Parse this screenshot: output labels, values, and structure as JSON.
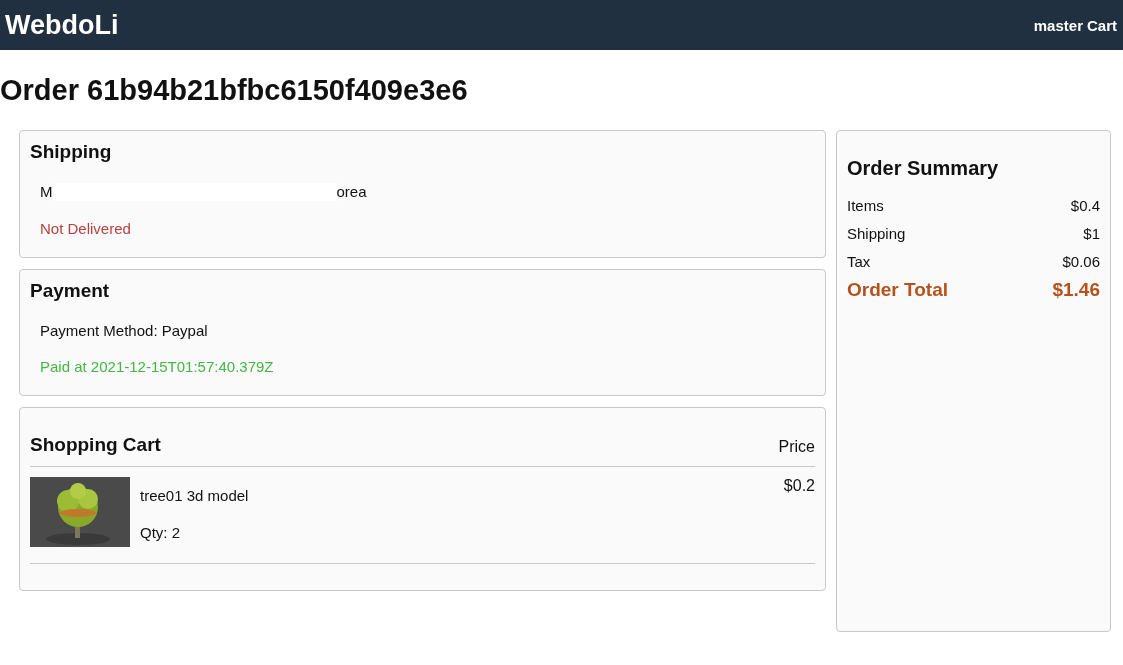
{
  "header": {
    "brand": "WebdoLi",
    "links": [
      "master",
      "Cart"
    ]
  },
  "title": "Order 61b94b21bfbc6150f409e3e6",
  "shipping": {
    "heading": "Shipping",
    "address_start": "M",
    "address_end": "orea",
    "status": "Not Delivered",
    "delivered": false
  },
  "payment": {
    "heading": "Payment",
    "method": "Payment Method: Paypal",
    "status": "Paid at 2021-12-15T01:57:40.379Z",
    "paid": true
  },
  "cart": {
    "heading": "Shopping Cart",
    "price_heading": "Price",
    "items": [
      {
        "name": "tree01 3d model",
        "qty": "Qty: 2",
        "price": "$0.2"
      }
    ]
  },
  "summary": {
    "heading": "Order Summary",
    "rows": [
      {
        "kind": "line",
        "label": "Items",
        "value": "$0.4"
      },
      {
        "kind": "line",
        "label": "Shipping",
        "value": "$1"
      },
      {
        "kind": "line",
        "label": "Tax",
        "value": "$0.06"
      },
      {
        "kind": "total",
        "label": "Order Total",
        "value": "$1.46"
      }
    ]
  }
}
